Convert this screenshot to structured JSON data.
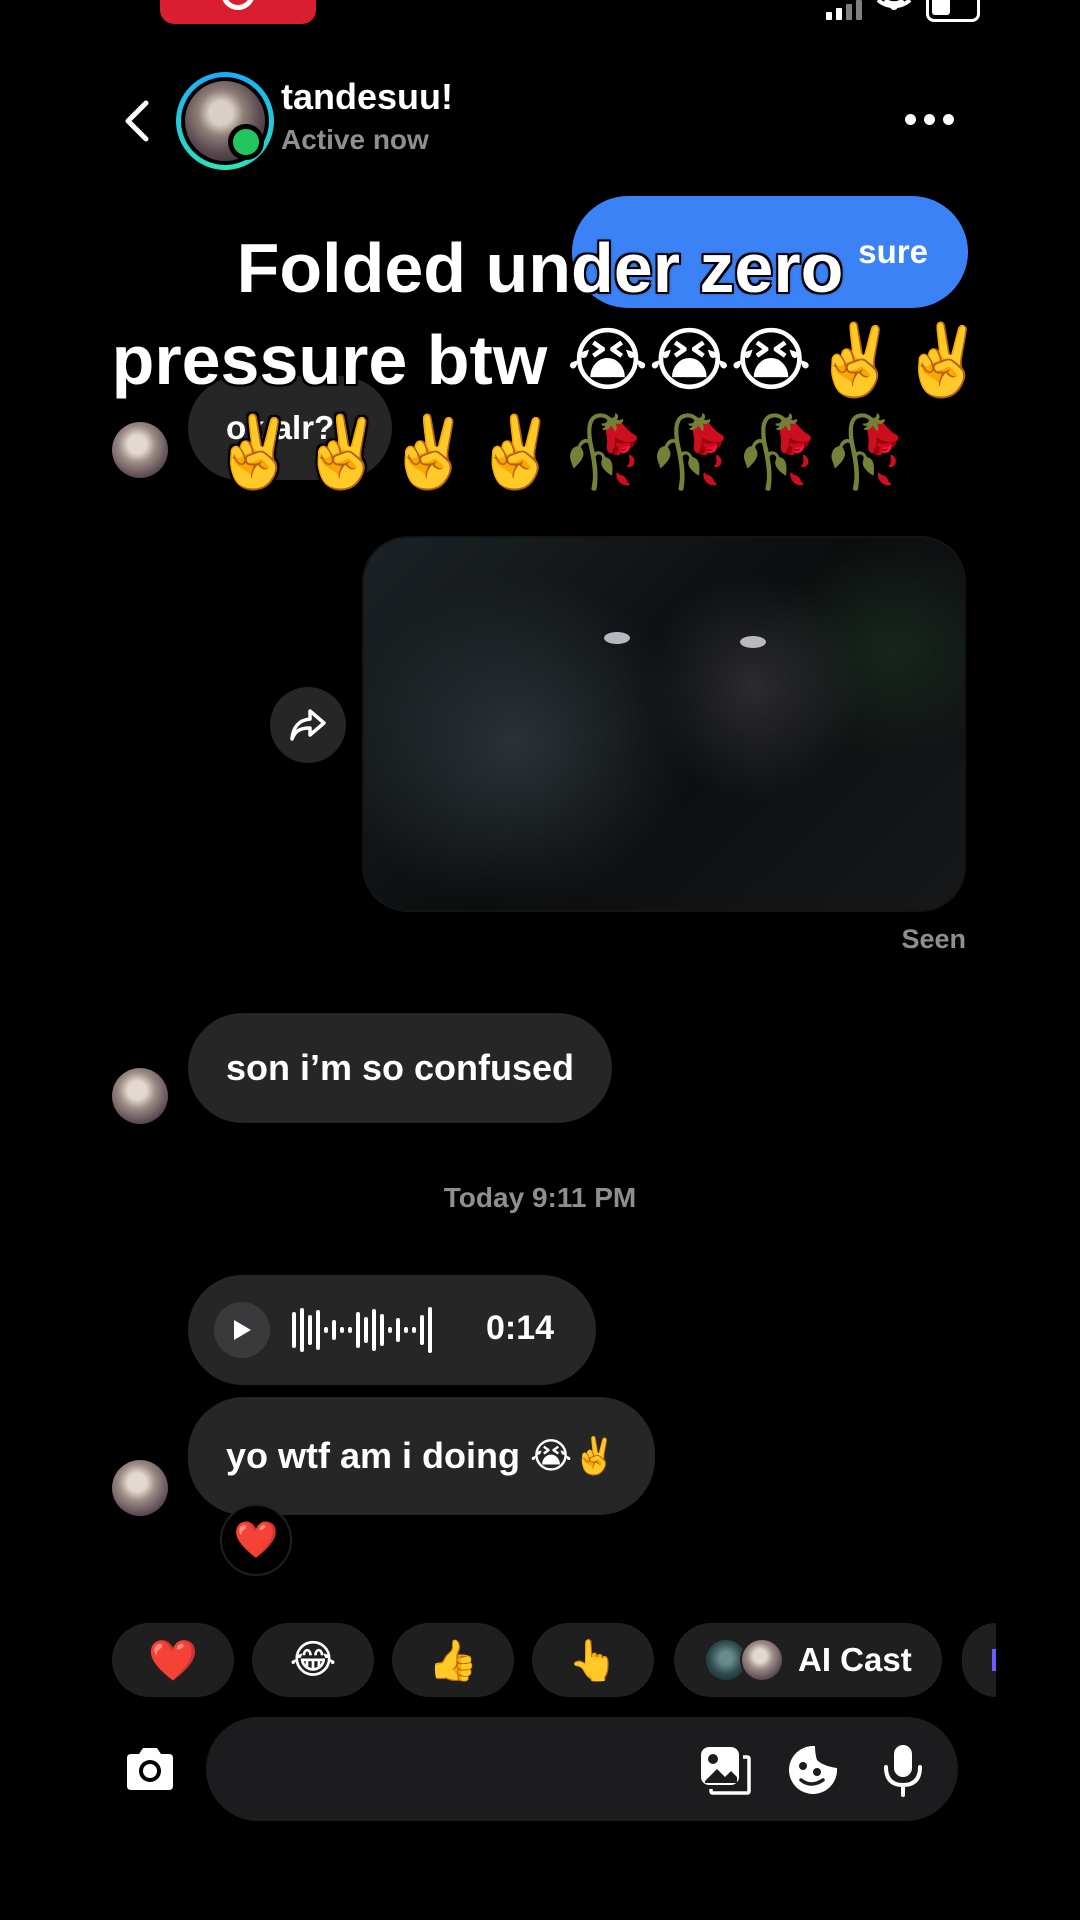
{
  "status_bar": {
    "recording_indicator": "screen-recording",
    "icons": [
      "signal-icon",
      "wifi-icon",
      "battery-icon"
    ]
  },
  "header": {
    "back_icon": "chevron-left-icon",
    "contact_name": "tandesuu!",
    "contact_status": "Active now",
    "more_icon": "more-horizontal-icon"
  },
  "overlay_caption": {
    "line1": "Folded under zero",
    "line2": "pressure btw 😭😭😭✌️✌️",
    "line3": "✌️✌️✌️✌️🥀🥀🥀🥀"
  },
  "messages": {
    "outgoing_partial": "sure",
    "incoming_partial": "ok alr?",
    "media_share_icon": "share-arrow-icon",
    "seen_label": "Seen",
    "msg_confused": "son i’m so confused",
    "timestamp": "Today 9:11 PM",
    "voice": {
      "play_icon": "play-icon",
      "duration": "0:14"
    },
    "msg_doing": "yo wtf am i doing 😭✌️",
    "reaction": "❤️"
  },
  "quick_reactions": {
    "heart": "❤️",
    "laugh": "😂",
    "thumbs": "👍",
    "point": "👆",
    "ai_cast_label": "AI Cast"
  },
  "composer": {
    "camera_icon": "camera-icon",
    "gallery_icon": "gallery-icon",
    "sticker_icon": "sticker-icon",
    "mic_icon": "microphone-icon"
  },
  "colors": {
    "background": "#000000",
    "bubble_incoming": "#262626",
    "bubble_outgoing": "#3b82f6",
    "online": "#22c55e",
    "muted_text": "#8e8e93"
  }
}
